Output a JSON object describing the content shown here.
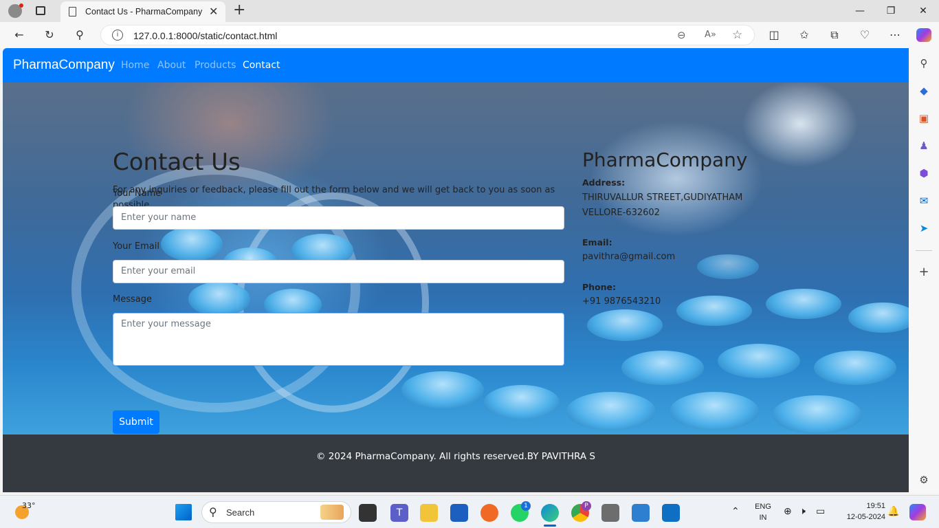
{
  "browser": {
    "tab_title": "Contact Us - PharmaCompany",
    "new_tab": "+",
    "url": "127.0.0.1:8000/static/contact.html"
  },
  "site": {
    "brand": "PharmaCompany",
    "nav": [
      {
        "label": "Home"
      },
      {
        "label": "About"
      },
      {
        "label": "Products"
      },
      {
        "label": "Contact"
      }
    ],
    "active_nav": "Contact"
  },
  "form": {
    "title": "Contact Us",
    "intro": "For any inquiries or feedback, please fill out the form below and we will get back to you as soon as possible.",
    "name_label": "Your Name",
    "name_placeholder": "Enter your name",
    "email_label": "Your Email",
    "email_placeholder": "Enter your email",
    "message_label": "Message",
    "message_placeholder": "Enter your message",
    "submit_label": "Submit"
  },
  "info": {
    "company": "PharmaCompany",
    "address_label": "Address:",
    "address_line1": "THIRUVALLUR STREET,GUDIYATHAM",
    "address_line2": "VELLORE-632602",
    "email_label": "Email:",
    "email_value": "pavithra@gmail.com",
    "phone_label": "Phone:",
    "phone_value": "+91 9876543210"
  },
  "footer": {
    "text": "© 2024 PharmaCompany. All rights reserved.BY PAVITHRA S"
  },
  "taskbar": {
    "weather": "33°",
    "search_label": "Search",
    "lang_line1": "ENG",
    "lang_line2": "IN",
    "time": "19:51",
    "date": "12-05-2024",
    "whatsapp_badge": "1",
    "chrome_badge": "P"
  },
  "colors": {
    "primary": "#007bff",
    "footer_bg": "#343a40"
  }
}
